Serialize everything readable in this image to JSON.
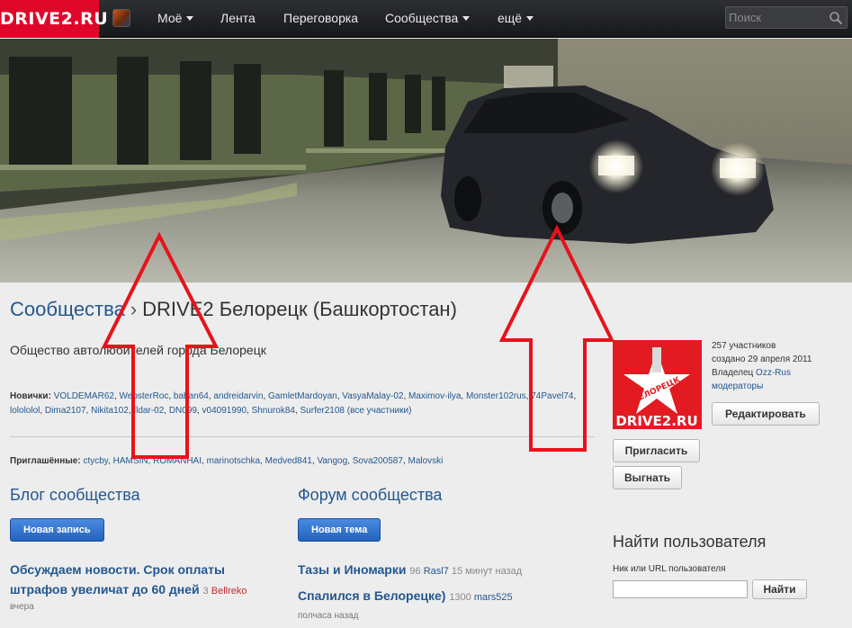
{
  "nav": {
    "logo": "DRIVE2.RU",
    "items": [
      {
        "label": "Моё",
        "dropdown": true
      },
      {
        "label": "Лента",
        "dropdown": false
      },
      {
        "label": "Переговорка",
        "dropdown": false
      },
      {
        "label": "Сообщества",
        "dropdown": true
      },
      {
        "label": "ещё",
        "dropdown": true
      }
    ],
    "search_placeholder": "Поиск"
  },
  "breadcrumb": {
    "root": "Сообщества",
    "separator": "›",
    "current": "DRIVE2 Белорецк (Башкортостан)"
  },
  "description": "Общество автолюбителей города Белорецк",
  "newbies": {
    "label": "Новички:",
    "users": [
      "VOLDEMAR62",
      "WebsterRoc",
      "baban64",
      "andreidarvin",
      "GamletMardoyan",
      "VasyaMalay-02",
      "Maximov-ilya",
      "Monster102rus",
      "74Pavel74",
      "lolololol",
      "Dima2107",
      "Nikita102",
      "Ildar-02",
      "DN099",
      "v04091990",
      "Shnurok84",
      "Surfer2108"
    ],
    "all_link": "(все участники)"
  },
  "invited": {
    "label": "Приглашённые:",
    "users": [
      "ctycby",
      "HAMSIN",
      "ROMANHAI",
      "marinotschka",
      "Medved841",
      "Vangog",
      "Sova200587",
      "Malovski"
    ]
  },
  "blog": {
    "title": "Блог сообщества",
    "new_button": "Новая запись",
    "post": {
      "title_line1": "Обсуждаем новости. Срок оплаты",
      "title_line2": "штрафов увеличат до 60 дней",
      "comments": "3",
      "author": "Bellreko",
      "time": "вчера"
    }
  },
  "forum": {
    "title": "Форум сообщества",
    "new_button": "Новая тема",
    "topics": [
      {
        "title": "Тазы и Иномарки",
        "count": "96",
        "author": "Rasl7",
        "time": "15 минут назад"
      },
      {
        "title": "Спалился в Белорецке)",
        "count": "1300",
        "author": "mars525",
        "time": "полчаса назад"
      }
    ]
  },
  "community": {
    "image_city": "БЕЛОРЕЦК",
    "image_brand": "DRIVE2.RU",
    "members": "257 участников",
    "created": "создано 29 апреля 2011",
    "owner_label": "Владелец",
    "owner": "Ozz-Rus",
    "moderators": "модераторы",
    "edit_button": "Редактировать",
    "invite_button": "Пригласить",
    "kick_button": "Выгнать"
  },
  "find_user": {
    "title": "Найти пользователя",
    "label": "Ник или URL пользователя",
    "button": "Найти"
  },
  "colors": {
    "brand_red": "#e0062a",
    "link_blue": "#23578f",
    "annotation_red": "#e8121b"
  }
}
